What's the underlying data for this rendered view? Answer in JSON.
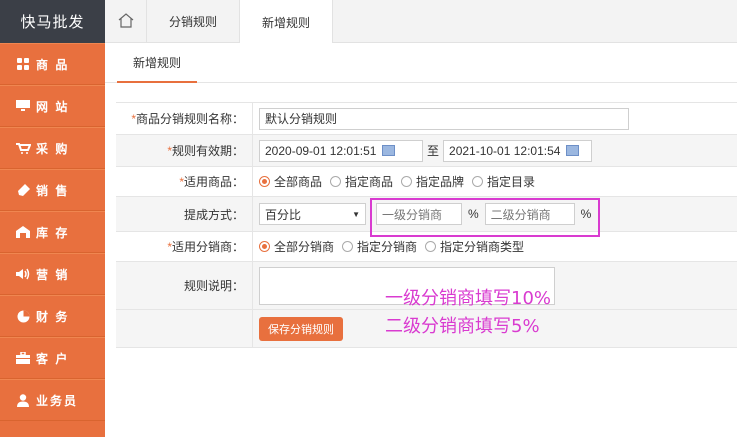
{
  "brand": "快马批发",
  "sidebar": {
    "items": [
      {
        "label": "商 品",
        "icon": "grid-icon"
      },
      {
        "label": "网 站",
        "icon": "monitor-icon"
      },
      {
        "label": "采 购",
        "icon": "cart-icon"
      },
      {
        "label": "销 售",
        "icon": "tag-icon"
      },
      {
        "label": "库 存",
        "icon": "warehouse-icon"
      },
      {
        "label": "营 销",
        "icon": "speaker-icon"
      },
      {
        "label": "财 务",
        "icon": "pie-chart-icon"
      },
      {
        "label": "客 户",
        "icon": "briefcase-icon"
      },
      {
        "label": "业务员",
        "icon": "user-icon"
      }
    ]
  },
  "topbar": {
    "tabs": [
      {
        "label": "分销规则"
      },
      {
        "label": "新增规则"
      }
    ]
  },
  "subtab": {
    "label": "新增规则"
  },
  "form": {
    "name_label": "商品分销规则名称：",
    "name_value": "默认分销规则",
    "validity_label": "规则有效期：",
    "start_date": "2020-09-01 12:01:51",
    "to_text": "至",
    "end_date": "2021-10-01 12:01:54",
    "goods_label": "适用商品：",
    "goods_options": [
      "全部商品",
      "指定商品",
      "指定品牌",
      "指定目录"
    ],
    "commission_label": "提成方式：",
    "commission_select": "百分比",
    "level1_placeholder": "一级分销商",
    "level2_placeholder": "二级分销商",
    "percent": "%",
    "distributor_label": "适用分销商：",
    "distributor_options": [
      "全部分销商",
      "指定分销商",
      "指定分销商类型"
    ],
    "desc_label": "规则说明：",
    "save_label": "保存分销规则"
  },
  "annotations": {
    "line1": "一级分销商填写10%",
    "line2": "二级分销商填写5%",
    "color": "#d93bd0"
  },
  "colors": {
    "accent": "#e8703e",
    "brand_bg": "#3b3f47"
  }
}
